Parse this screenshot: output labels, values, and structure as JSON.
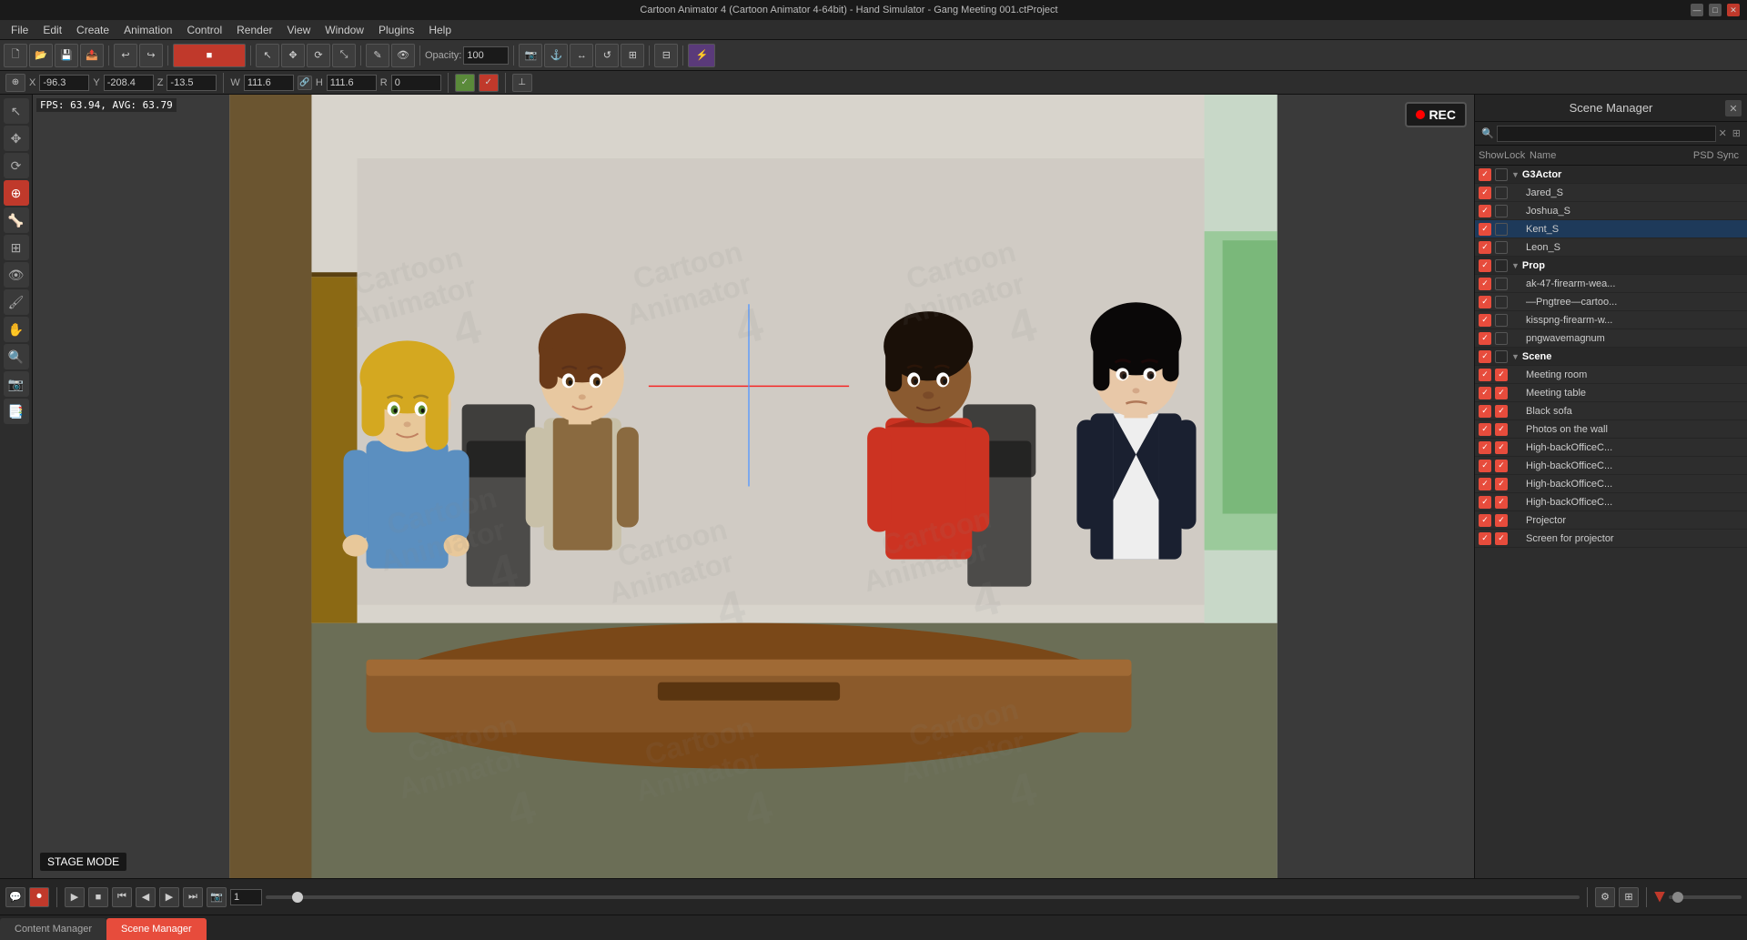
{
  "titleBar": {
    "title": "Cartoon Animator 4 (Cartoon Animator 4-64bit) - Hand Simulator - Gang Meeting 001.ctProject",
    "minimize": "—",
    "maximize": "□",
    "close": "✕"
  },
  "menuBar": {
    "items": [
      "File",
      "Edit",
      "Create",
      "Animation",
      "Control",
      "Render",
      "View",
      "Window",
      "Plugins",
      "Help"
    ]
  },
  "toolbar": {
    "opacity_label": "Opacity:",
    "opacity_value": "100"
  },
  "positionBar": {
    "x_label": "X",
    "x_value": "-96.3",
    "y_label": "Y",
    "y_value": "-208.4",
    "z_label": "Z",
    "z_value": "-13.5",
    "w_label": "W",
    "w_value": "111.6",
    "h_label": "H",
    "h_value": "111.6",
    "r_label": "R",
    "r_value": "0"
  },
  "viewport": {
    "fps_text": "FPS: 63.94, AVG: 63.79",
    "rec_label": "REC",
    "stage_mode_label": "STAGE MODE"
  },
  "sceneManager": {
    "title": "Scene Manager",
    "search_placeholder": "",
    "columns": {
      "show": "Show",
      "lock": "Lock",
      "name": "Name",
      "psd_sync": "PSD Sync"
    },
    "tree": [
      {
        "id": "g3actor",
        "label": "G3Actor",
        "type": "group",
        "indent": 0,
        "expanded": true,
        "show": true,
        "lock": false
      },
      {
        "id": "jared_s",
        "label": "Jared_S",
        "type": "item",
        "indent": 1,
        "show": true,
        "lock": false
      },
      {
        "id": "joshua_s",
        "label": "Joshua_S",
        "type": "item",
        "indent": 1,
        "show": true,
        "lock": false
      },
      {
        "id": "kent_s",
        "label": "Kent_S",
        "type": "item",
        "indent": 1,
        "show": true,
        "lock": false,
        "selected": true
      },
      {
        "id": "leon_s",
        "label": "Leon_S",
        "type": "item",
        "indent": 1,
        "show": true,
        "lock": false
      },
      {
        "id": "prop",
        "label": "Prop",
        "type": "group",
        "indent": 0,
        "expanded": true,
        "show": true,
        "lock": false
      },
      {
        "id": "ak47",
        "label": "ak-47-firearm-wea...",
        "type": "item",
        "indent": 1,
        "show": true,
        "lock": false
      },
      {
        "id": "pngtree",
        "label": "—Pngtree—cartoo...",
        "type": "item",
        "indent": 1,
        "show": true,
        "lock": false
      },
      {
        "id": "kisspng",
        "label": "kisspng-firearm-w...",
        "type": "item",
        "indent": 1,
        "show": true,
        "lock": false
      },
      {
        "id": "pngwave",
        "label": "pngwavemagnum",
        "type": "item",
        "indent": 1,
        "show": true,
        "lock": false
      },
      {
        "id": "scene",
        "label": "Scene",
        "type": "group",
        "indent": 0,
        "expanded": true,
        "show": true,
        "lock": false
      },
      {
        "id": "meeting_room",
        "label": "Meeting room",
        "type": "item",
        "indent": 1,
        "show": true,
        "lock": true
      },
      {
        "id": "meeting_table",
        "label": "Meeting table",
        "type": "item",
        "indent": 1,
        "show": true,
        "lock": true
      },
      {
        "id": "black_sofa",
        "label": "Black sofa",
        "type": "item",
        "indent": 1,
        "show": true,
        "lock": true
      },
      {
        "id": "photos_wall",
        "label": "Photos on the wall",
        "type": "item",
        "indent": 1,
        "show": true,
        "lock": true
      },
      {
        "id": "highback1",
        "label": "High-backOfficeC...",
        "type": "item",
        "indent": 1,
        "show": true,
        "lock": true
      },
      {
        "id": "highback2",
        "label": "High-backOfficeC...",
        "type": "item",
        "indent": 1,
        "show": true,
        "lock": true
      },
      {
        "id": "highback3",
        "label": "High-backOfficeC...",
        "type": "item",
        "indent": 1,
        "show": true,
        "lock": true
      },
      {
        "id": "highback4",
        "label": "High-backOfficeC...",
        "type": "item",
        "indent": 1,
        "show": true,
        "lock": true
      },
      {
        "id": "projector",
        "label": "Projector",
        "type": "item",
        "indent": 1,
        "show": true,
        "lock": true
      },
      {
        "id": "screen_proj",
        "label": "Screen for projector",
        "type": "item",
        "indent": 1,
        "show": true,
        "lock": true
      }
    ]
  },
  "timeline": {
    "frame_value": "1",
    "play": "▶",
    "stop": "■",
    "prev_frame": "◀◀",
    "next_frame": "▶▶",
    "first": "⏮",
    "last": "⏭",
    "record": "⏺"
  },
  "bottomTabs": {
    "content_manager": "Content Manager",
    "scene_manager": "Scene Manager"
  }
}
